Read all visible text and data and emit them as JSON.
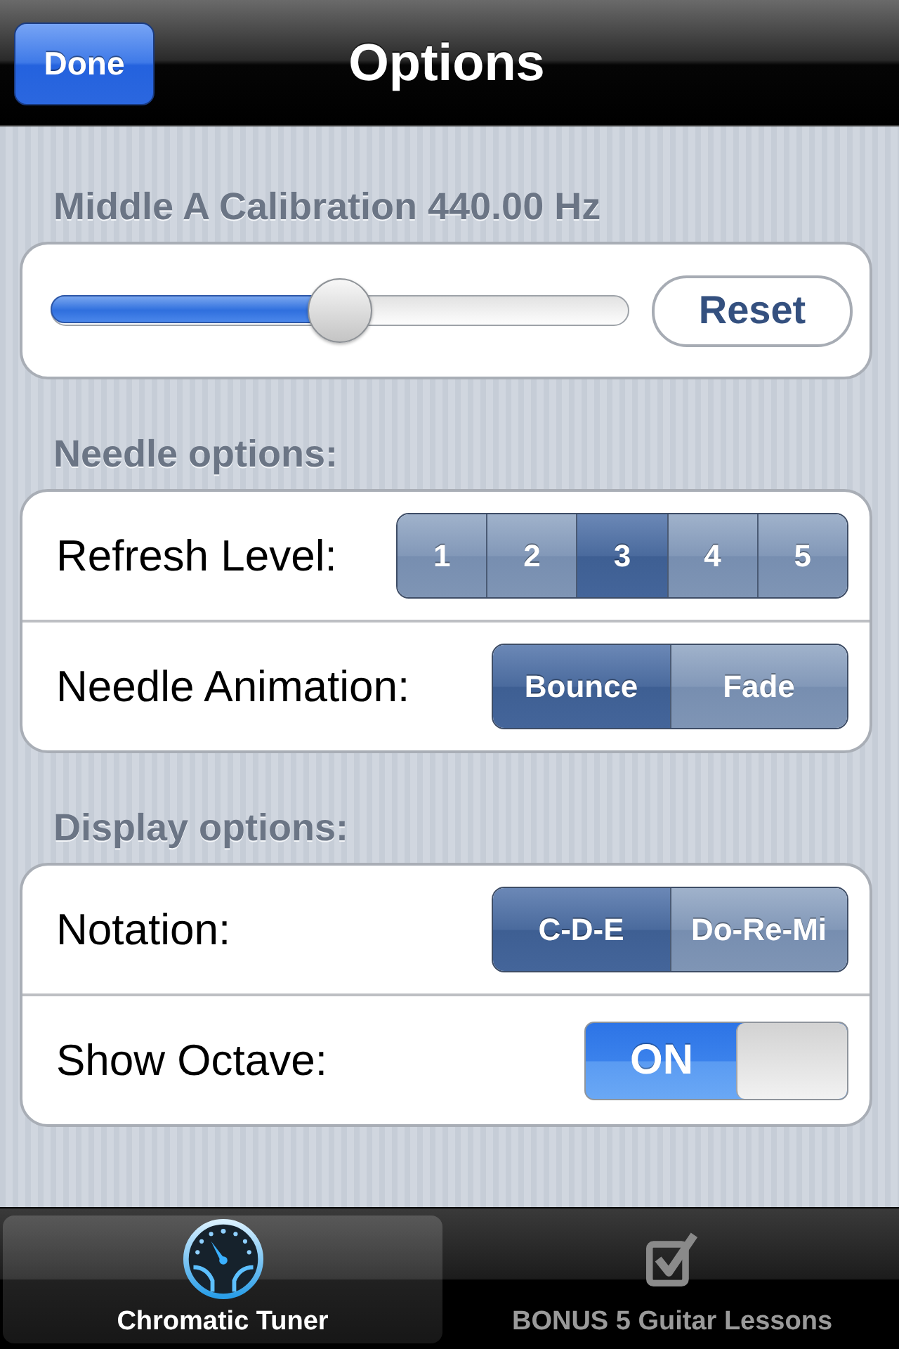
{
  "nav_bar": {
    "done_button": "Done",
    "title": "Options"
  },
  "sections": [
    {
      "header": "Middle A Calibration 440.00 Hz",
      "rows": [
        {
          "kind": "slider",
          "level": 0.5,
          "button": "Reset"
        }
      ]
    },
    {
      "header": "Needle options:",
      "rows": [
        {
          "kind": "segmented",
          "label": "Refresh Level:",
          "segments": [
            {
              "label": "1",
              "selected": false
            },
            {
              "label": "2",
              "selected": false
            },
            {
              "label": "3",
              "selected": true
            },
            {
              "label": "4",
              "selected": false
            },
            {
              "label": "5",
              "selected": false
            }
          ]
        },
        {
          "kind": "segmented",
          "label": "Needle Animation:",
          "segments": [
            {
              "label": "Bounce",
              "selected": true
            },
            {
              "label": "Fade",
              "selected": false
            }
          ]
        }
      ]
    },
    {
      "header": "Display options:",
      "rows": [
        {
          "kind": "segmented",
          "label": "Notation:",
          "segments": [
            {
              "label": "C-D-E",
              "selected": true
            },
            {
              "label": "Do-Re-Mi",
              "selected": false
            }
          ]
        },
        {
          "kind": "switch",
          "label": "Show Octave:",
          "on": true,
          "on_text": "ON"
        }
      ]
    }
  ],
  "tab_bar": {
    "items": [
      {
        "label": "Chromatic Tuner",
        "selected": true
      },
      {
        "label": "BONUS 5 Guitar Lessons",
        "selected": false
      }
    ]
  }
}
